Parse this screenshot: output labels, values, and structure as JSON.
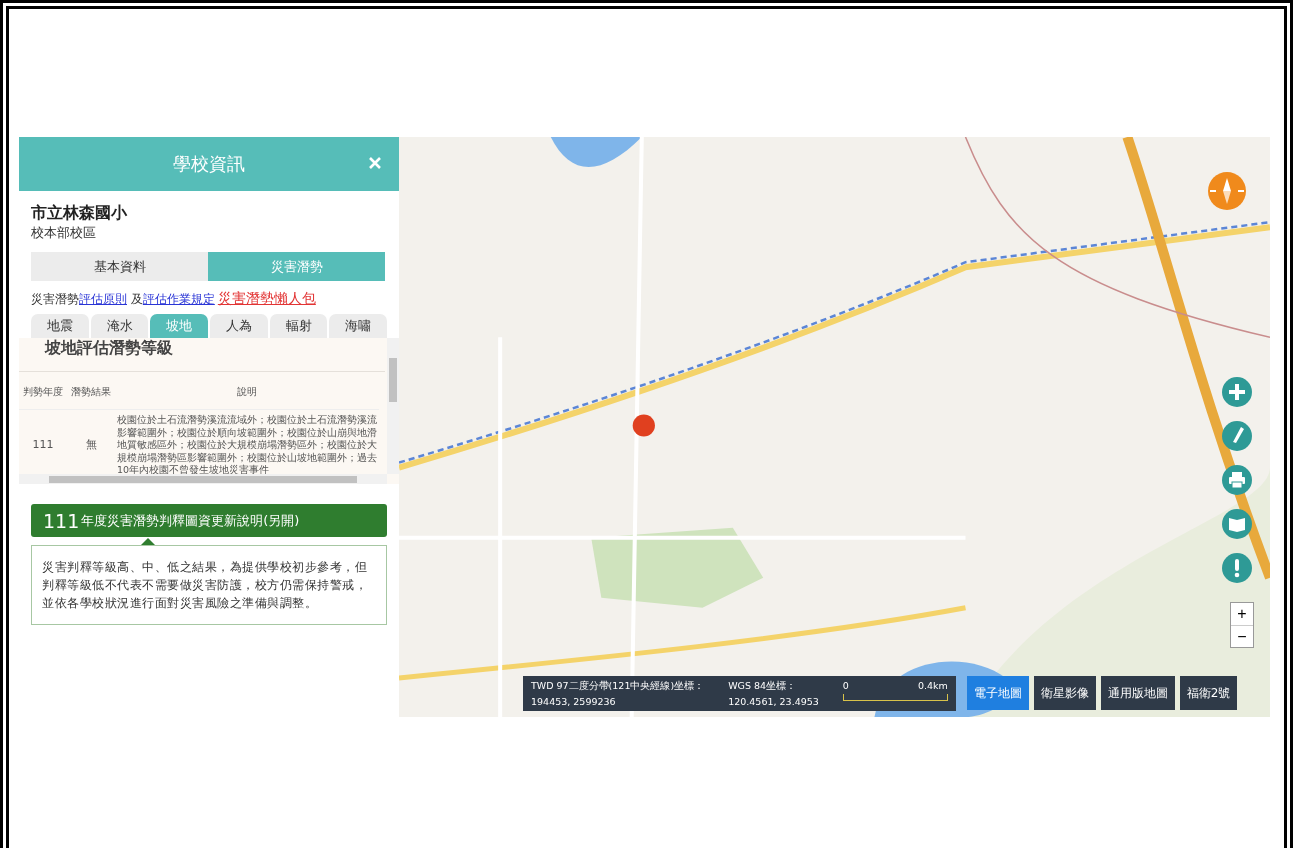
{
  "panel": {
    "title": "學校資訊",
    "school_name": "市立林森國小",
    "campus": "校本部校區",
    "main_tabs": [
      {
        "label": "基本資料",
        "selected": false
      },
      {
        "label": "災害潛勢",
        "selected": true
      }
    ],
    "links_line": [
      {
        "kind": "text",
        "text": "災害潛勢"
      },
      {
        "kind": "link",
        "text": "評估原則"
      },
      {
        "kind": "text",
        "text": " 及"
      },
      {
        "kind": "link",
        "text": "評估作業規定"
      },
      {
        "kind": "hotlink",
        "text": "災害潛勢懶人包"
      }
    ],
    "hazard_tabs": [
      {
        "label": "地震",
        "selected": false
      },
      {
        "label": "淹水",
        "selected": false
      },
      {
        "label": "坡地",
        "selected": true
      },
      {
        "label": "人為",
        "selected": false
      },
      {
        "label": "輻射",
        "selected": false
      },
      {
        "label": "海嘯",
        "selected": false
      }
    ],
    "section_title": "坡地評估潛勢等級",
    "table": {
      "columns": [
        "判勢年度",
        "潛勢結果",
        "說明"
      ],
      "rows": [
        [
          "111",
          "無",
          "校園位於土石流潛勢溪流流域外；校園位於土石流潛勢溪流影響範圍外；校園位於順向坡範圍外；校園位於山崩與地滑地質敏感區外；校園位於大規模崩塌潛勢區外；校園位於大規模崩塌潛勢區影響範圍外；校園位於山坡地範圍外；過去10年內校園不曾發生坡地災害事件"
        ]
      ]
    },
    "notice": {
      "year": "111",
      "title": "年度災害潛勢判釋圖資更新說明(另開)",
      "body": "災害判釋等級高、中、低之結果，為提供學校初步參考，但判釋等級低不代表不需要做災害防護，校方仍需保持警戒，並依各學校狀況進行面對災害風險之準備與調整。"
    }
  },
  "map": {
    "zoom_in": "+",
    "zoom_out": "−",
    "coords": [
      {
        "label": "TWD 97二度分帶(121中央經線)坐標：",
        "value": "194453, 2599236"
      },
      {
        "label": "WGS 84坐標：",
        "value": "120.4561, 23.4953"
      }
    ],
    "scale": {
      "start": "0",
      "end": "0.4km"
    },
    "basemaps": [
      {
        "label": "電子地圖",
        "selected": true
      },
      {
        "label": "衛星影像",
        "selected": false
      },
      {
        "label": "通用版地圖",
        "selected": false
      },
      {
        "label": "福衛2號",
        "selected": false
      }
    ]
  }
}
